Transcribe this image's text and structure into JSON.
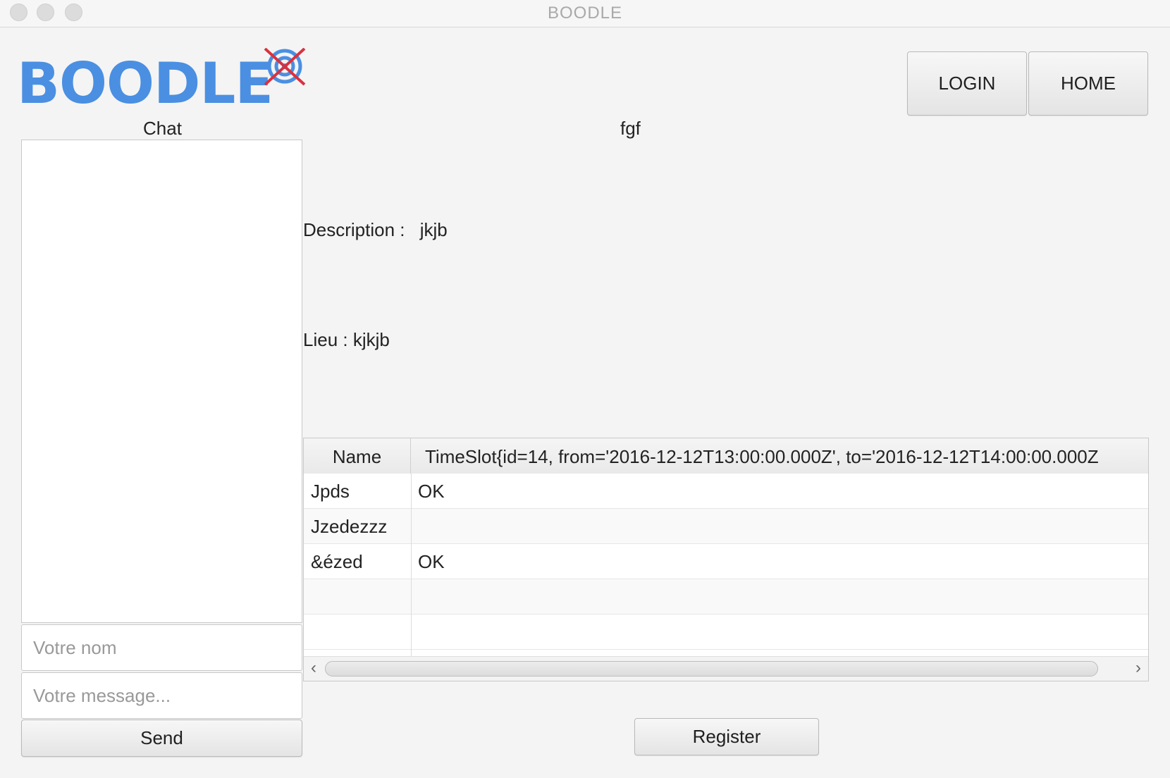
{
  "window": {
    "title": "BOODLE"
  },
  "logo": {
    "text": "BOODLE"
  },
  "header": {
    "login_label": "LOGIN",
    "home_label": "HOME"
  },
  "chat": {
    "title": "Chat",
    "name_placeholder": "Votre nom",
    "message_placeholder": "Votre message...",
    "send_label": "Send"
  },
  "event": {
    "title": "fgf",
    "description_label": "Description :",
    "description_value": "jkjb",
    "lieu_text": "Lieu : kjkjb"
  },
  "table": {
    "columns": [
      "Name",
      "TimeSlot{id=14, from='2016-12-12T13:00:00.000Z', to='2016-12-12T14:00:00.000Z"
    ],
    "rows": [
      {
        "name": "Jpds",
        "value": "OK"
      },
      {
        "name": "Jzedezzz",
        "value": ""
      },
      {
        "name": "&ézed",
        "value": "OK"
      },
      {
        "name": "",
        "value": ""
      },
      {
        "name": "",
        "value": ""
      }
    ]
  },
  "register_label": "Register",
  "colors": {
    "logo_blue": "#4a8fe2",
    "logo_mark_red": "#d9323e",
    "background": "#f4f4f4"
  }
}
